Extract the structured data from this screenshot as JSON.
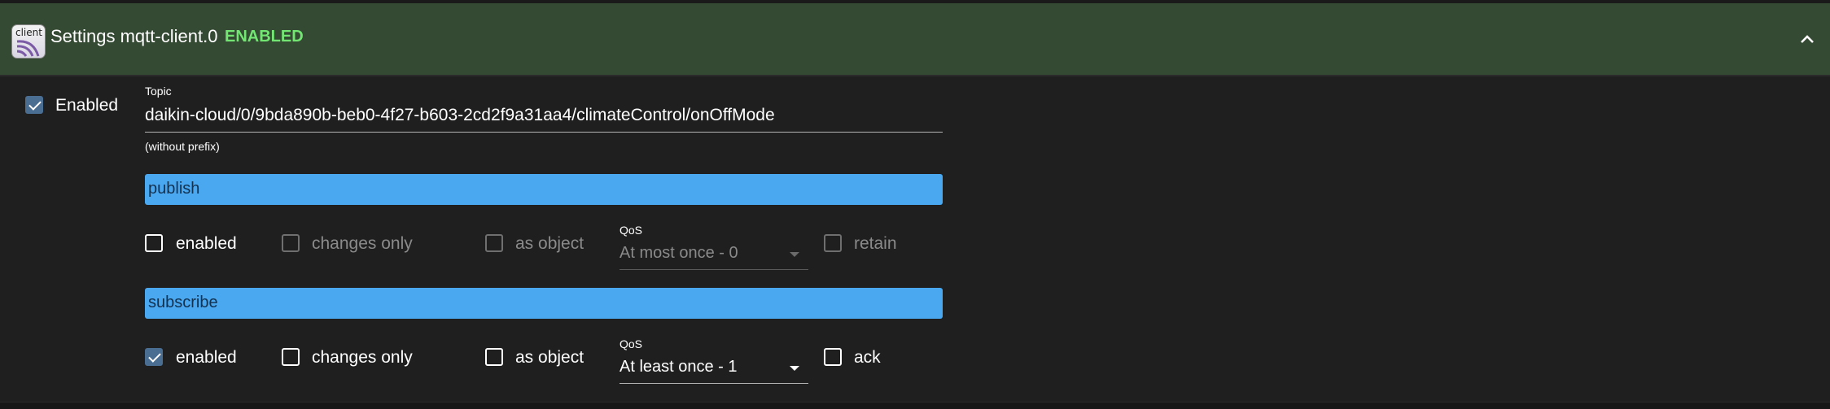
{
  "header": {
    "logo_text": "client",
    "title": "Settings mqtt-client.0",
    "status": "ENABLED"
  },
  "enabled_main": {
    "label": "Enabled",
    "checked": true
  },
  "topic": {
    "label": "Topic",
    "value": "daikin-cloud/0/9bda890b-beb0-4f27-b603-2cd2f9a31aa4/climateControl/onOffMode",
    "helper": "(without prefix)"
  },
  "publish": {
    "title": "publish",
    "enabled_label": "enabled",
    "changes_only_label": "changes only",
    "as_object_label": "as object",
    "qos_label": "QoS",
    "qos_value": "At most once - 0",
    "retain_label": "retain"
  },
  "subscribe": {
    "title": "subscribe",
    "enabled_label": "enabled",
    "changes_only_label": "changes only",
    "as_object_label": "as object",
    "qos_label": "QoS",
    "qos_value": "At least once - 1",
    "ack_label": "ack"
  },
  "colors": {
    "header_bg": "#344a33",
    "status_green": "#72e573",
    "bar_blue": "#4aa8f1",
    "checked_blue": "#4a6d92"
  }
}
